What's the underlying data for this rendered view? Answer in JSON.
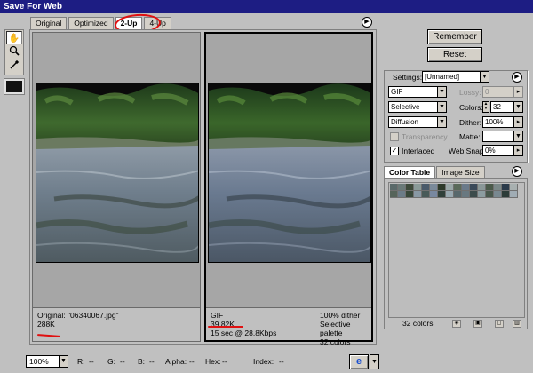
{
  "window": {
    "title": "Save For Web"
  },
  "tabs": [
    {
      "label": "Original"
    },
    {
      "label": "Optimized"
    },
    {
      "label": "2-Up"
    },
    {
      "label": "4-Up"
    }
  ],
  "tools": [
    {
      "icon": "hand-icon"
    },
    {
      "icon": "zoom-icon"
    },
    {
      "icon": "eyedropper-icon"
    }
  ],
  "icons": {
    "flyout_menu": "play-circle-icon",
    "browser": "internet-explorer-icon"
  },
  "colors": {
    "annotation": "#e01010",
    "title_bar": "#1d1d83",
    "selection_swatch": "#111111"
  },
  "panes": {
    "original": {
      "line1": "Original: \"06340067.jpg\"",
      "line2": "288K"
    },
    "optimized": {
      "left": [
        "GIF",
        "39.82K",
        "15 sec @ 28.8Kbps"
      ],
      "right": [
        "100% dither",
        "Selective palette",
        "32 colors"
      ]
    }
  },
  "buttons": {
    "remember": "Remember",
    "reset": "Reset"
  },
  "settings": {
    "label": "Settings:",
    "preset": "[Unnamed]",
    "format": "GIF",
    "lossy_label": "Lossy:",
    "lossy_value": "0",
    "palette": "Selective",
    "colors_label": "Colors:",
    "colors_value": "32",
    "dither_algo": "Diffusion",
    "dither_label": "Dither:",
    "dither_value": "100%",
    "transparency_label": "Transparency",
    "matte_label": "Matte:",
    "interlaced_label": "Interlaced",
    "interlaced_checked": "✓",
    "websnap_label": "Web Snap:",
    "websnap_value": "0%"
  },
  "color_table": {
    "tab_label": "Color Table",
    "tab2_label": "Image Size",
    "count": "32 colors",
    "swatches": [
      "#5a6a6a",
      "#6a7a78",
      "#3d4a3a",
      "#8a9a98",
      "#4a5a6a",
      "#7a8a9a",
      "#2d3a2a",
      "#9aa8a8",
      "#5a6a5a",
      "#6a7a8a",
      "#3a4a5a",
      "#8a9898",
      "#4a5a4a",
      "#7a8888",
      "#2a3a4a",
      "#a8b0b0",
      "#56645a",
      "#6c7c88",
      "#38483a",
      "#8898a4",
      "#485a58",
      "#7888a0",
      "#30403a",
      "#98a8b0",
      "#58686c",
      "#687880",
      "#3c4c4c",
      "#8c9ca0",
      "#48584c",
      "#788890",
      "#2c3c38",
      "#a0acb4"
    ]
  },
  "statusbar": {
    "zoom": "100%",
    "r": "R:",
    "r_val": "--",
    "g": "G:",
    "g_val": "--",
    "b": "B:",
    "b_val": "--",
    "alpha": "Alpha:",
    "alpha_val": "--",
    "hex": "Hex:",
    "hex_val": "--",
    "index": "Index:",
    "index_val": "--"
  }
}
